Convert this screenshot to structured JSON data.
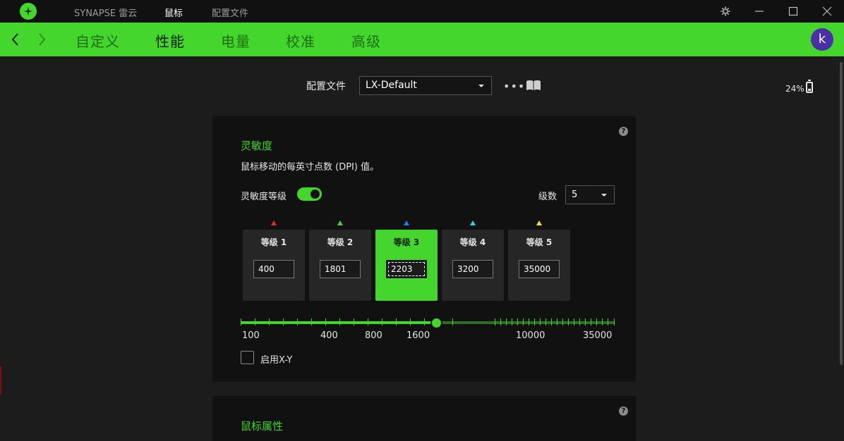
{
  "titlebar": {
    "tabs": [
      {
        "label": "SYNAPSE 雷云",
        "active": false
      },
      {
        "label": "鼠标",
        "active": true
      },
      {
        "label": "配置文件",
        "active": false
      }
    ],
    "icons": [
      "razer-logo-icon",
      "gear-icon",
      "minimize-icon",
      "maximize-icon",
      "close-icon"
    ]
  },
  "navbar": {
    "tabs": [
      {
        "label": "自定义",
        "active": false
      },
      {
        "label": "性能",
        "active": true
      },
      {
        "label": "电量",
        "active": false
      },
      {
        "label": "校准",
        "active": false
      },
      {
        "label": "高级",
        "active": false
      }
    ],
    "avatar_letter": "k",
    "accent": "#44d62c"
  },
  "profile": {
    "label": "配置文件",
    "selected": "LX-Default"
  },
  "battery": {
    "percent_text": "24%"
  },
  "sensitivity": {
    "title": "灵敏度",
    "description": "鼠标移动的每英寸点数 (DPI) 值。",
    "stages_label": "灵敏度等级",
    "stages_enabled": true,
    "levels_label": "级数",
    "levels_value": "5",
    "stages": [
      {
        "name": "等级 1",
        "value": "400",
        "color": "#e52a2a",
        "active": false
      },
      {
        "name": "等级 2",
        "value": "1801",
        "color": "#44d62c",
        "active": false
      },
      {
        "name": "等级 3",
        "value": "2203",
        "color": "#2a7fe5",
        "active": true
      },
      {
        "name": "等级 4",
        "value": "3200",
        "color": "#2ad6e5",
        "active": false
      },
      {
        "name": "等级 5",
        "value": "35000",
        "color": "#f2e52a",
        "active": false
      }
    ],
    "slider_labels": [
      "100",
      "400",
      "800",
      "1600",
      "10000",
      "35000"
    ],
    "slider_value": 2203,
    "xy_label": "启用X-Y",
    "xy_enabled": false
  },
  "mouse_properties": {
    "title": "鼠标属性"
  }
}
